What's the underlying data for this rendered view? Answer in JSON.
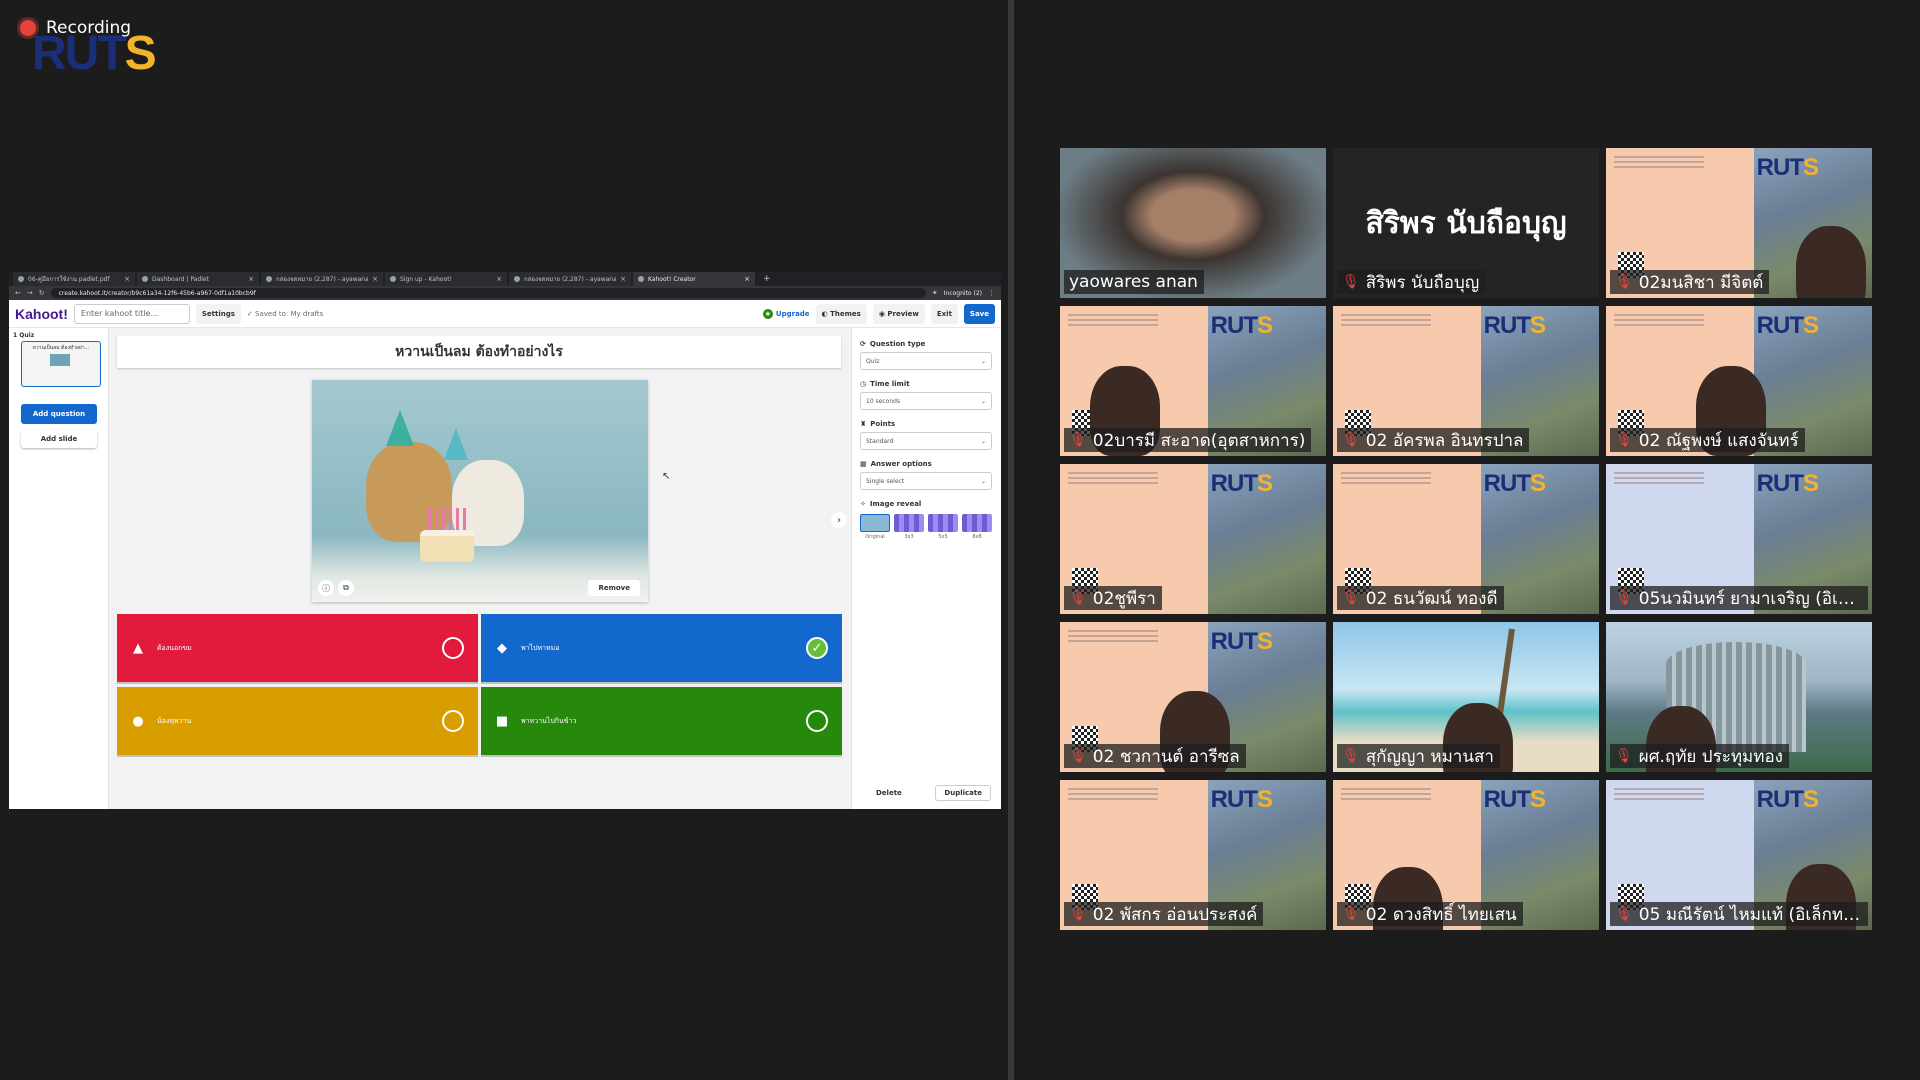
{
  "recording": {
    "label": "Recording"
  },
  "logo": {
    "main_a": "RUT",
    "main_b": "S"
  },
  "browser": {
    "tabs": [
      {
        "title": "06-คู่มือการใช้งาน padlet.pdf",
        "active": false
      },
      {
        "title": "Dashboard | Padlet",
        "active": false
      },
      {
        "title": "กล่องจดหมาย (2,287) - ayawanan...",
        "active": false
      },
      {
        "title": "Sign up - Kahoot!",
        "active": false
      },
      {
        "title": "กล่องจดหมาย (2,287) - ayawanan...",
        "active": false
      },
      {
        "title": "Kahoot! Creator",
        "active": true
      }
    ],
    "url": "create.kahoot.it/creator/b9c61a34-12f6-45b6-a967-0df1a10bcb9f",
    "incognito": "Incognito (2)"
  },
  "kahoot": {
    "logo": "Kahoot!",
    "title_placeholder": "Enter kahoot title...",
    "settings": "Settings",
    "saved": "Saved to: My drafts",
    "upgrade": "Upgrade",
    "themes": "Themes",
    "preview": "Preview",
    "exit": "Exit",
    "save": "Save",
    "slide": {
      "num": "1 Quiz",
      "thumb_text": "หวานเป็นลม ต้องทำอย่า..."
    },
    "add_question": "Add question",
    "add_slide": "Add slide",
    "question": "หวานเป็นลม ต้องทำอย่างไร",
    "remove": "Remove",
    "answers": [
      {
        "text": "ต้องนอกขม",
        "color": "#e21b3c",
        "shape": "triangle",
        "correct": false
      },
      {
        "text": "พาไปหาหมอ",
        "color": "#1368ce",
        "shape": "diamond",
        "correct": true
      },
      {
        "text": "น้องหุหวาน",
        "color": "#d89e00",
        "shape": "circle",
        "correct": false
      },
      {
        "text": "พาหวานไปกินข้าว",
        "color": "#26890c",
        "shape": "square",
        "correct": false
      }
    ],
    "panel": {
      "question_type_label": "Question type",
      "question_type": "Quiz",
      "time_limit_label": "Time limit",
      "time_limit": "10 seconds",
      "points_label": "Points",
      "points": "Standard",
      "answer_options_label": "Answer options",
      "answer_options": "Single select",
      "image_reveal_label": "Image reveal",
      "reveal_options": [
        "Original",
        "3x3",
        "5x5",
        "8x8"
      ],
      "delete": "Delete",
      "duplicate": "Duplicate"
    }
  },
  "participants": [
    {
      "name": "yaowares anan",
      "type": "face",
      "muted": false,
      "active": true
    },
    {
      "name": "สิริพร นับถือบุญ",
      "type": "name",
      "muted": true,
      "active": false,
      "display": "สิริพร นับถือบุญ"
    },
    {
      "name": "02มนสิชา มีจิตต์",
      "type": "slide",
      "muted": true,
      "active": false
    },
    {
      "name": "02บารมี สะอาด(อุตสาหการ)",
      "type": "slide",
      "muted": true,
      "active": false
    },
    {
      "name": "02 อัครพล อินทรปาล",
      "type": "slide",
      "muted": true,
      "active": false
    },
    {
      "name": "02 ณัฐพงษ์ แสงจันทร์",
      "type": "slide",
      "muted": true,
      "active": false
    },
    {
      "name": "02ชูพีรา",
      "type": "slide",
      "muted": true,
      "active": false
    },
    {
      "name": "02 ธนวัฒน์ ทองดี",
      "type": "slide",
      "muted": true,
      "active": false
    },
    {
      "name": "05นวมินทร์ ยามาเจริญ (อิเล็ก...",
      "type": "slide-blue",
      "muted": true,
      "active": false
    },
    {
      "name": "02 ชวกานต์ อารีซล",
      "type": "slide",
      "muted": true,
      "active": false
    },
    {
      "name": "สุกัญญา หมานสา",
      "type": "beach",
      "muted": true,
      "active": false
    },
    {
      "name": "ผศ.ฤทัย ประทุมทอง",
      "type": "building",
      "muted": true,
      "active": false
    },
    {
      "name": "02 พัสกร อ่อนประสงค์",
      "type": "slide",
      "muted": true,
      "active": false
    },
    {
      "name": "02 ดวงสิทธิ์ ไทยเสน",
      "type": "slide",
      "muted": true,
      "active": false
    },
    {
      "name": "05 มณีรัตน์ ไหมแท้ (อิเล็กทรอ...",
      "type": "slide-blue",
      "muted": true,
      "active": false
    }
  ]
}
